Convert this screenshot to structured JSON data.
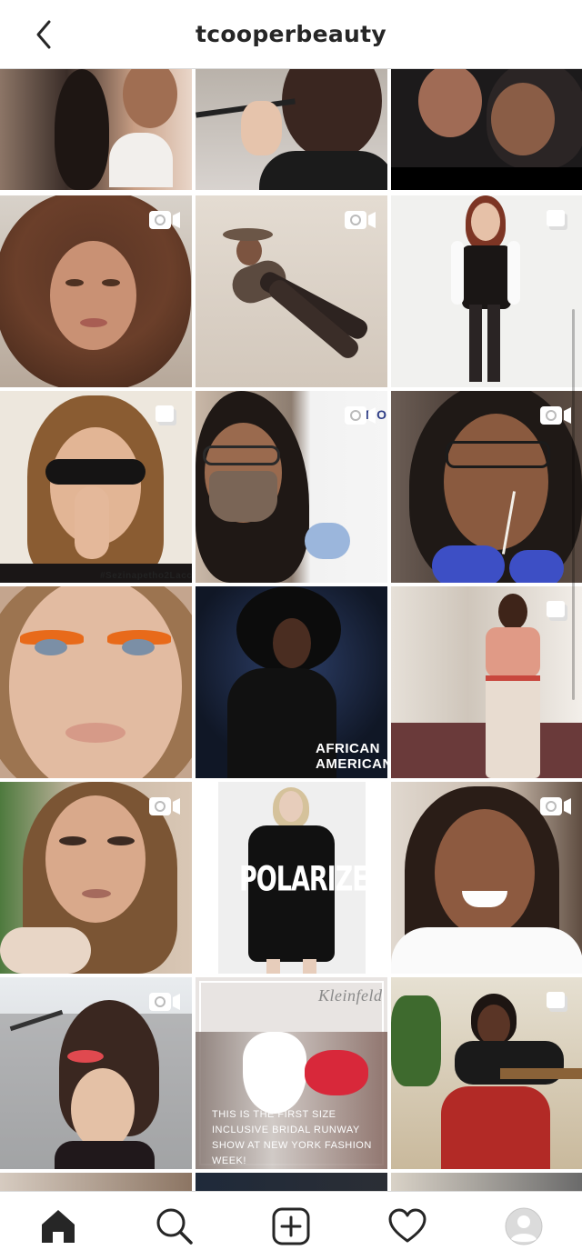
{
  "header": {
    "title": "tcooperbeauty",
    "back_icon": "chevron-left-icon"
  },
  "posts": [
    {
      "type": "image",
      "caption": ""
    },
    {
      "type": "image",
      "caption": ""
    },
    {
      "type": "image",
      "caption": ""
    },
    {
      "type": "video",
      "caption": ""
    },
    {
      "type": "video",
      "caption": ""
    },
    {
      "type": "carousel",
      "caption": ""
    },
    {
      "type": "carousel",
      "caption": "#Sezinapetho2Lacc"
    },
    {
      "type": "video",
      "caption": "ROMO"
    },
    {
      "type": "video",
      "caption": ""
    },
    {
      "type": "image",
      "caption": ""
    },
    {
      "type": "image",
      "caption": "AFRICAN AMERICANS"
    },
    {
      "type": "carousel",
      "caption": ""
    },
    {
      "type": "video",
      "caption": ""
    },
    {
      "type": "image",
      "caption": "POLARIZED"
    },
    {
      "type": "video",
      "caption": ""
    },
    {
      "type": "video",
      "caption": ""
    },
    {
      "type": "image",
      "caption": "THIS IS THE FIRST SIZE INCLUSIVE BRIDAL RUNWAY SHOW AT NEW YORK FASHION WEEK!",
      "brand": "Kleinfeld"
    },
    {
      "type": "carousel",
      "caption": ""
    }
  ],
  "bottom_nav": {
    "items": [
      "home-icon",
      "search-icon",
      "new-post-icon",
      "activity-heart-icon",
      "profile-avatar"
    ]
  },
  "colors": {
    "border": "#dbdbdb",
    "text": "#262626",
    "icon": "#262626"
  }
}
